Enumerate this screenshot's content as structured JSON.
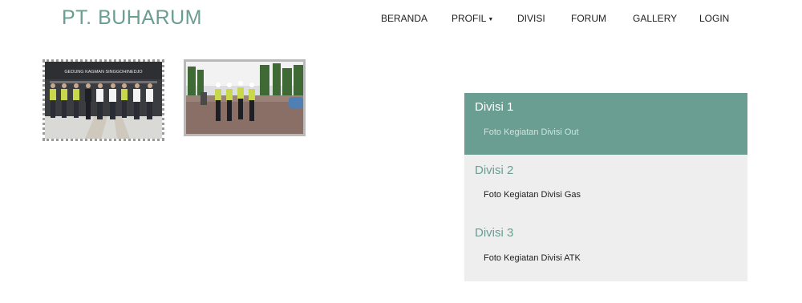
{
  "brand": {
    "title": "PT. BUHARUM"
  },
  "nav": {
    "items": [
      {
        "label": "BERANDA"
      },
      {
        "label": "PROFIL"
      },
      {
        "label": "DIVISI"
      },
      {
        "label": "FORUM"
      },
      {
        "label": "GALLERY"
      },
      {
        "label": "LOGIN"
      }
    ]
  },
  "gallery": {
    "photo1_sign": "GEDUNG KAGMAN SINGGOHINEDJO"
  },
  "divisions": [
    {
      "title": "Divisi 1",
      "link": "Foto Kegiatan Divisi Out"
    },
    {
      "title": "Divisi 2",
      "link": "Foto Kegiatan Divisi Gas"
    },
    {
      "title": "Divisi 3",
      "link": "Foto Kegiatan Divisi ATK"
    }
  ],
  "colors": {
    "accent": "#6a9e92",
    "panel_bg": "#eeeeee"
  }
}
